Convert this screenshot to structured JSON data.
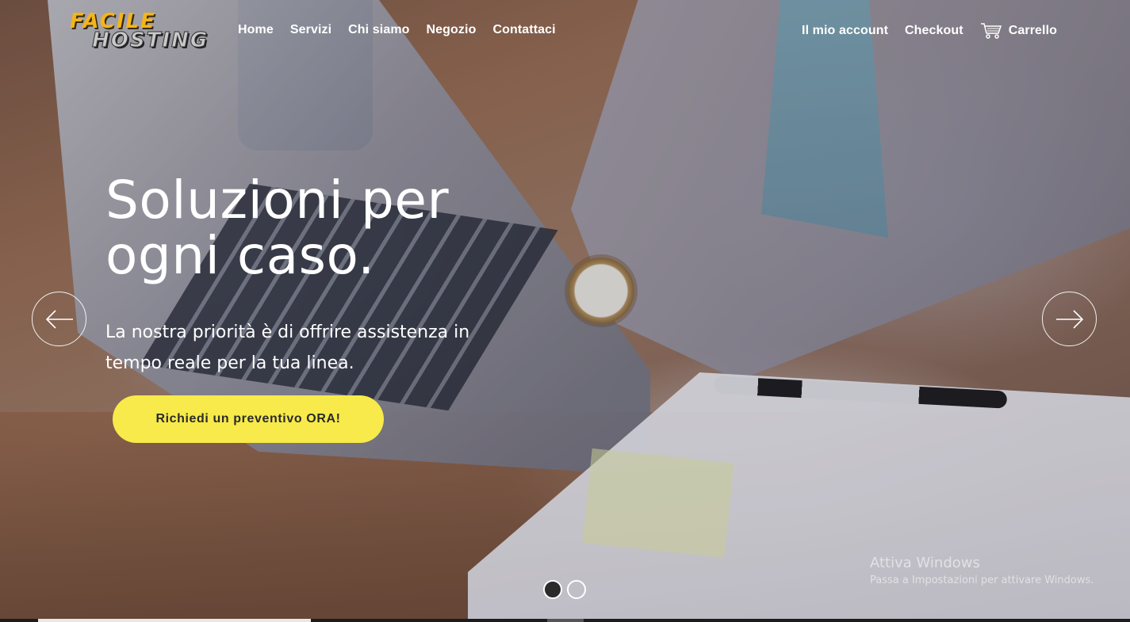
{
  "logo": {
    "line1": "FACILE",
    "line2": "HOSTING"
  },
  "nav": {
    "left": [
      {
        "label": "Home"
      },
      {
        "label": "Servizi"
      },
      {
        "label": "Chi siamo"
      },
      {
        "label": "Negozio"
      },
      {
        "label": "Contattaci"
      }
    ],
    "right": [
      {
        "label": "Il mio account"
      },
      {
        "label": "Checkout"
      },
      {
        "label": "Carrello",
        "icon": "cart-icon"
      }
    ]
  },
  "hero": {
    "headline": "Soluzioni per ogni caso.",
    "subtext": "La nostra priorità è di offrire assistenza in tempo reale per la tua linea.",
    "cta_label": "Richiedi un preventivo ORA!",
    "prev_icon": "arrow-left-icon",
    "next_icon": "arrow-right-icon"
  },
  "slider": {
    "slides": 2,
    "active": 1
  },
  "watermark": {
    "title": "Attiva Windows",
    "subtitle": "Passa a Impostazioni per attivare Windows."
  },
  "colors": {
    "cta": "#f7ea4a",
    "logo_accent": "#f3b51a",
    "text": "#ffffff"
  }
}
